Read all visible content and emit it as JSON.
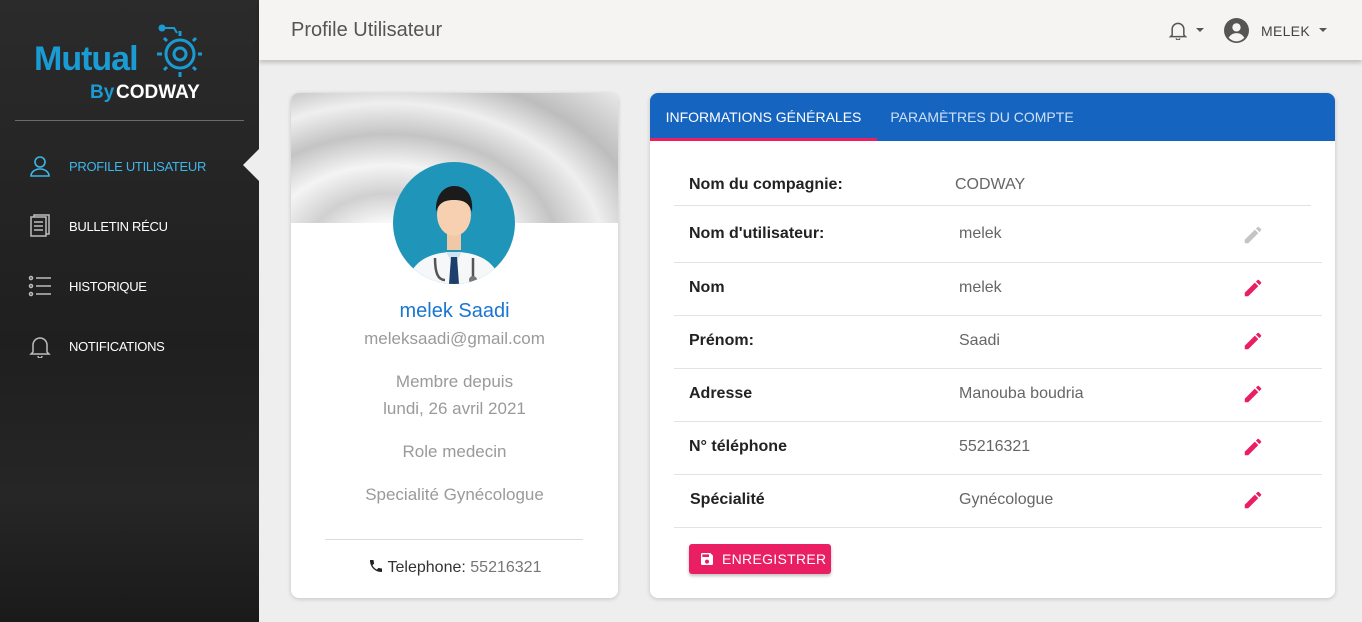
{
  "brand": {
    "name": "Mutual",
    "by": "By",
    "company": "CODWAY"
  },
  "sidebar": {
    "items": [
      {
        "label": "PROFILE UTILISATEUR",
        "icon": "user-icon",
        "active": true
      },
      {
        "label": "BULLETIN RÉCU",
        "icon": "document-icon"
      },
      {
        "label": "HISTORIQUE",
        "icon": "list-icon"
      },
      {
        "label": "NOTIFICATIONS",
        "icon": "bell-icon"
      }
    ]
  },
  "topbar": {
    "title": "Profile Utilisateur",
    "user": "MELEK"
  },
  "profile": {
    "name": "melek Saadi",
    "email": "meleksaadi@gmail.com",
    "member_label": "Membre depuis",
    "member_date": "lundi, 26 avril 2021",
    "role": "Role medecin",
    "speciality": "Specialité Gynécologue",
    "phone_label": "Telephone:",
    "phone": "55216321"
  },
  "info": {
    "tabs": [
      {
        "label": "INFORMATIONS GÉNÉRALES",
        "active": true
      },
      {
        "label": "PARAMÈTRES DU COMPTE"
      }
    ],
    "rows": [
      {
        "key": "Nom du compagnie:",
        "value": "CODWAY"
      },
      {
        "key": "Nom d'utilisateur:",
        "value": "melek"
      },
      {
        "key": "Nom",
        "value": "melek"
      },
      {
        "key": "Prénom:",
        "value": "Saadi"
      },
      {
        "key": "Adresse",
        "value": "Manouba boudria"
      },
      {
        "key": "N° téléphone",
        "value": "55216321"
      },
      {
        "key": "Spécialité",
        "value": "Gynécologue"
      }
    ],
    "save_label": "ENREGISTRER"
  },
  "colors": {
    "accent": "#e91e63",
    "primary": "#1565c0",
    "brand": "#1a9bd4",
    "disabled_icon": "#c4c4c4"
  }
}
